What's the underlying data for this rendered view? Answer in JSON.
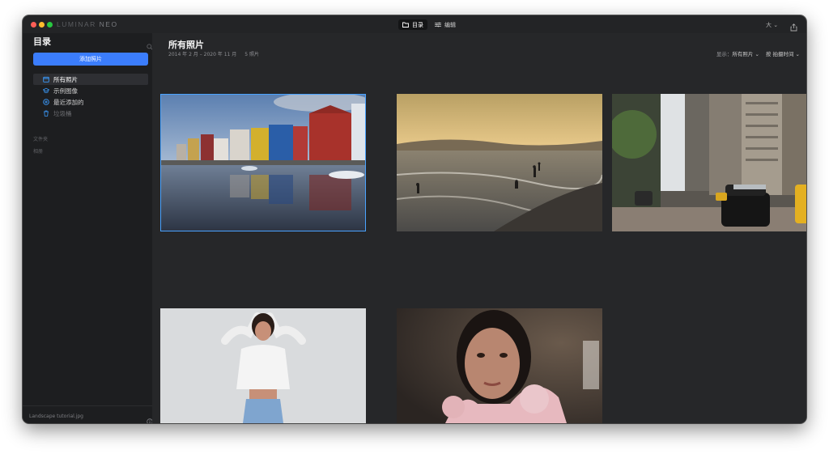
{
  "app": {
    "brand_main": "LUMINAR",
    "brand_accent": "NEO",
    "modes": [
      {
        "label": "目录",
        "icon": "folder-icon",
        "active": true
      },
      {
        "label": "编辑",
        "icon": "sliders-icon",
        "active": false
      }
    ],
    "zoom_label": "大 ⌄"
  },
  "sidebar": {
    "title": "目录",
    "add_button": "添加照片",
    "items": [
      {
        "label": "所有照片",
        "icon": "calendar-icon"
      },
      {
        "label": "示例图像",
        "icon": "graduation-cap-icon"
      },
      {
        "label": "最近添加的",
        "icon": "plus-circle-icon"
      },
      {
        "label": "垃圾桶",
        "icon": "trash-icon"
      }
    ],
    "section_folders": "文件夹",
    "section_albums": "相册",
    "footer_filename": "Landscape tutorial.jpg"
  },
  "main": {
    "title": "所有照片",
    "date_range": "2014 年 2 月 – 2020 年 11 月",
    "count": "5 照片",
    "show_label": "显示：",
    "show_value": "所有照片 ⌄",
    "sort_value": "按 拍摄时间 ⌄"
  },
  "colors": {
    "accent": "#3b7dfc",
    "selection": "#4aa3ff"
  }
}
